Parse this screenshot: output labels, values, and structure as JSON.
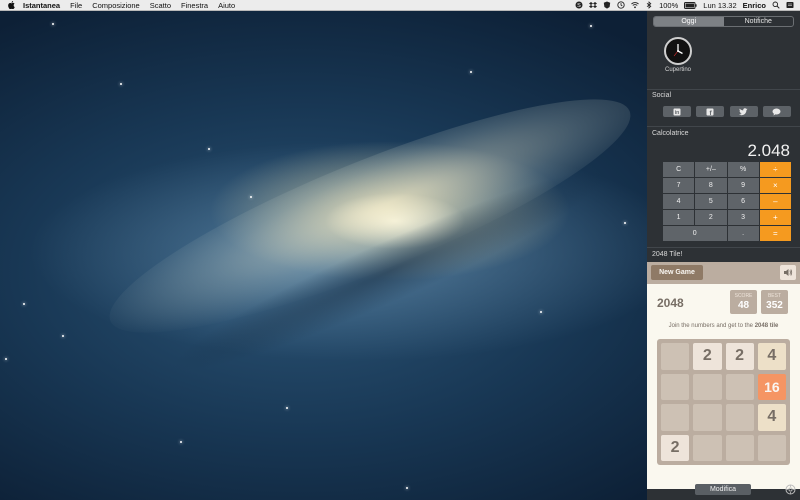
{
  "menubar": {
    "app_name": "Istantanea",
    "menus": [
      "File",
      "Composizione",
      "Scatto",
      "Finestra",
      "Aiuto"
    ],
    "battery": "100%",
    "clock": "Lun 13.32",
    "user": "Enrico"
  },
  "notification_center": {
    "tabs": [
      {
        "label": "Oggi",
        "active": true
      },
      {
        "label": "Notifiche",
        "active": false
      }
    ],
    "world_clock": {
      "city": "Cupertino"
    },
    "social": {
      "title": "Social",
      "buttons": [
        "linkedin-icon",
        "facebook-icon",
        "twitter-icon",
        "message-icon"
      ]
    },
    "calculator": {
      "title": "Calcolatrice",
      "display": "2.048",
      "keys": [
        "C",
        "+/–",
        "%",
        "÷",
        "7",
        "8",
        "9",
        "×",
        "4",
        "5",
        "6",
        "–",
        "1",
        "2",
        "3",
        "+",
        "0",
        ".",
        "="
      ]
    },
    "game": {
      "title": "2048 Tile!",
      "new_game_label": "New Game",
      "name": "2048",
      "score_label": "SCORE",
      "score": "48",
      "best_label": "BEST",
      "best": "352",
      "tagline_prefix": "Join the numbers and get to the",
      "tagline_bold": "2048 tile",
      "board": [
        [
          "",
          "2",
          "2",
          "4"
        ],
        [
          "",
          "",
          "",
          "16"
        ],
        [
          "",
          "",
          "",
          "4"
        ],
        [
          "2",
          "",
          "",
          ""
        ]
      ]
    },
    "edit_label": "Modifica"
  },
  "colors": {
    "orange_key": "#f59a1f",
    "tile_2": "#eee4da",
    "tile_4": "#ede0c8",
    "tile_16": "#f59563",
    "board": "#bbada0"
  }
}
